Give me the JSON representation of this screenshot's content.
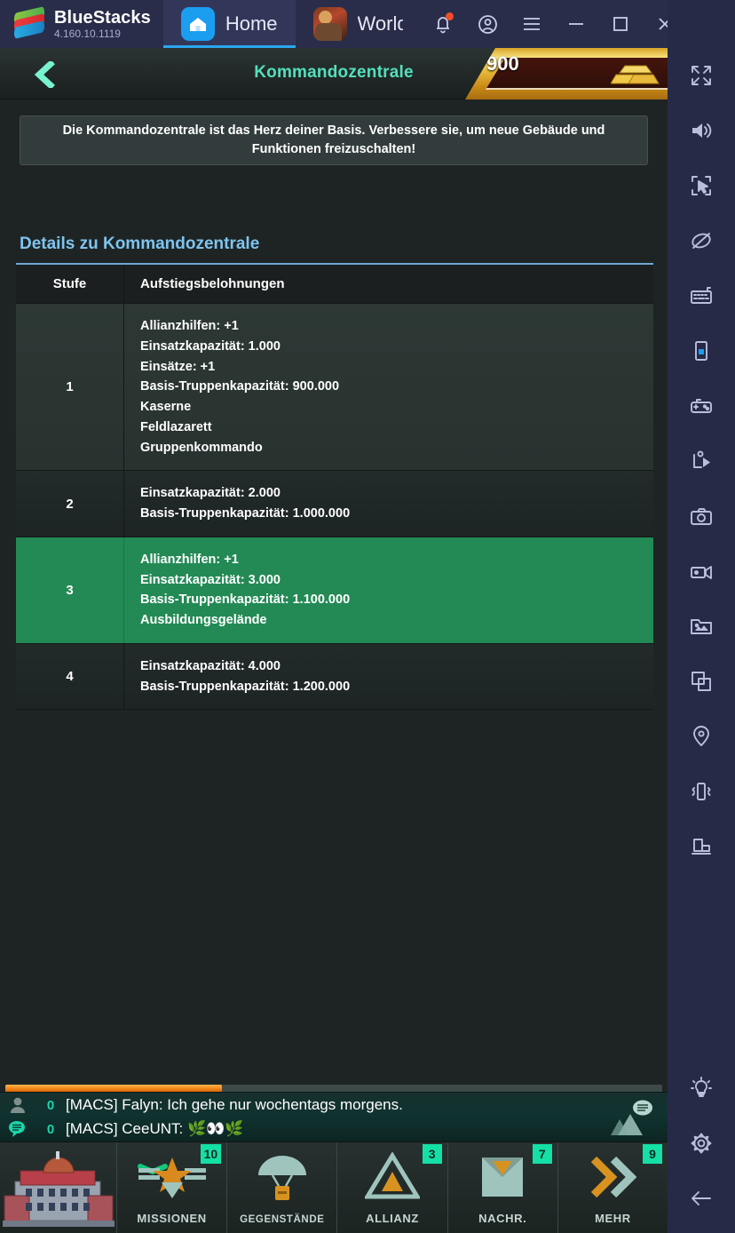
{
  "emulator": {
    "brand_name": "BlueStacks",
    "version": "4.160.10.1119",
    "tabs": [
      {
        "label": "Home",
        "icon": "home-icon",
        "active": true
      },
      {
        "label": "World W",
        "icon": "game-app-icon",
        "active": false
      }
    ],
    "window_controls": [
      {
        "name": "notifications-button",
        "icon": "bell-icon",
        "badge": true
      },
      {
        "name": "account-button",
        "icon": "account-circle-icon"
      },
      {
        "name": "menu-button",
        "icon": "hamburger-icon"
      },
      {
        "name": "minimize-button",
        "icon": "minimize-icon"
      },
      {
        "name": "maximize-button",
        "icon": "maximize-icon"
      },
      {
        "name": "close-button",
        "icon": "close-icon"
      },
      {
        "name": "collapse-sidebar-button",
        "icon": "chevron-double-left-icon"
      }
    ]
  },
  "sidebar": {
    "top_tools": [
      {
        "name": "fullscreen-button",
        "icon": "fullscreen-icon"
      },
      {
        "name": "volume-button",
        "icon": "speaker-icon"
      },
      {
        "name": "cursor-capture-button",
        "icon": "cursor-target-icon"
      },
      {
        "name": "disable-ads-button",
        "icon": "eye-off-icon"
      },
      {
        "name": "keyboard-controls-button",
        "icon": "keyboard-icon"
      },
      {
        "name": "device-profile-button",
        "icon": "phone-icon"
      },
      {
        "name": "gamepad-button",
        "icon": "gamepad-icon"
      },
      {
        "name": "macro-recorder-button",
        "icon": "script-play-icon"
      },
      {
        "name": "screenshot-button",
        "icon": "camera-icon"
      },
      {
        "name": "screen-record-button",
        "icon": "video-camera-icon"
      },
      {
        "name": "media-manager-button",
        "icon": "image-folder-icon"
      },
      {
        "name": "multi-instance-button",
        "icon": "copy-windows-icon"
      },
      {
        "name": "location-button",
        "icon": "map-pin-icon"
      },
      {
        "name": "shake-button",
        "icon": "shake-device-icon"
      },
      {
        "name": "rotate-button",
        "icon": "rotate-screen-icon"
      }
    ],
    "bottom_tools": [
      {
        "name": "tips-button",
        "icon": "lightbulb-icon"
      },
      {
        "name": "settings-button",
        "icon": "gear-icon"
      },
      {
        "name": "back-button",
        "icon": "arrow-left-icon"
      }
    ]
  },
  "game": {
    "header": {
      "back_icon": "chevron-left-icon",
      "title": "Kommandozentrale",
      "currency": {
        "amount": "900",
        "icon": "gold-bars-icon",
        "color": "#e8bb3b"
      }
    },
    "description": "Die Kommandozentrale ist das Herz deiner Basis. Verbessere sie, um neue Gebäude und Funktionen freizuschalten!",
    "details": {
      "heading": "Details zu Kommandozentrale",
      "columns": [
        "Stufe",
        "Aufstiegsbelohnungen"
      ],
      "rows": [
        {
          "level": "1",
          "rewards": [
            "Allianzhilfen: +1",
            "Einsatzkapazität: 1.000",
            "Einsätze: +1",
            "Basis-Truppenkapazität: 900.000",
            "Kaserne",
            "Feldlazarett",
            "Gruppenkommando"
          ],
          "style": "light"
        },
        {
          "level": "2",
          "rewards": [
            "Einsatzkapazität: 2.000",
            "Basis-Truppenkapazität: 1.000.000"
          ],
          "style": "dark"
        },
        {
          "level": "3",
          "rewards": [
            "Allianzhilfen: +1",
            "Einsatzkapazität: 3.000",
            "Basis-Truppenkapazität: 1.100.000",
            "Ausbildungsgelände"
          ],
          "style": "sel"
        },
        {
          "level": "4",
          "rewards": [
            "Einsatzkapazität: 4.000",
            "Basis-Truppenkapazität: 1.200.000"
          ],
          "style": "dark"
        }
      ],
      "selected_color": "#238a55"
    },
    "progress_percent": 33,
    "chat": {
      "lines": [
        {
          "icon": "player-icon",
          "count": "0",
          "message": "[MACS] Falyn: Ich gehe nur wochentags morgens."
        },
        {
          "icon": "chat-bubble-icon",
          "count": "0",
          "message": "[MACS] CeeUNT: 🌿👀🌿"
        }
      ],
      "world_chat_icon": "world-chat-icon"
    },
    "bottom_nav": {
      "hq_icon": "headquarters-building-icon",
      "items": [
        {
          "label": "MISSIONEN",
          "icon": "rank-star-icon",
          "badge": "10",
          "checked": true
        },
        {
          "label": "GEGENSTÄNDE",
          "icon": "parachute-crate-icon",
          "badge": ""
        },
        {
          "label": "ALLIANZ",
          "icon": "alliance-triangle-icon",
          "badge": "3"
        },
        {
          "label": "NACHR.",
          "icon": "envelope-icon",
          "badge": "7"
        },
        {
          "label": "MEHR",
          "icon": "chevron-double-right-icon",
          "badge": "9"
        }
      ],
      "badge_color": "#14e0a6"
    }
  }
}
